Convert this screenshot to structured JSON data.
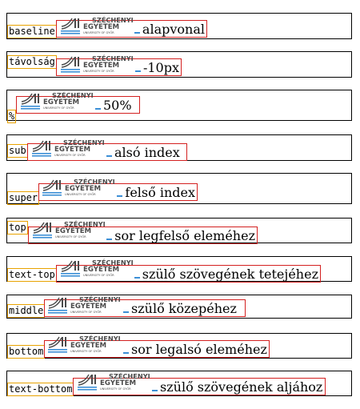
{
  "logo": {
    "line1": "SZÉCHENYI",
    "line2": "EGYETEM",
    "line3": "UNIVERSITY OF GYŐR",
    "accent": "#3c8fd6",
    "dark": "#4a4a4a"
  },
  "rows": [
    {
      "label": "baseline",
      "text": "alapvonal"
    },
    {
      "label": "távolság",
      "text": "-10px"
    },
    {
      "label": "%",
      "text": "50%"
    },
    {
      "label": "sub",
      "text": "alsó index"
    },
    {
      "label": "super",
      "text": "felső index"
    },
    {
      "label": "top",
      "text": "sor legfelső eleméhez"
    },
    {
      "label": "text-top",
      "text": "szülő szövegének tetejéhez"
    },
    {
      "label": "middle",
      "text": "szülő közepéhez"
    },
    {
      "label": "bottom",
      "text": "sor legalsó eleméhez"
    },
    {
      "label": "text-bottom",
      "text": "szülő szövegének aljához"
    }
  ]
}
